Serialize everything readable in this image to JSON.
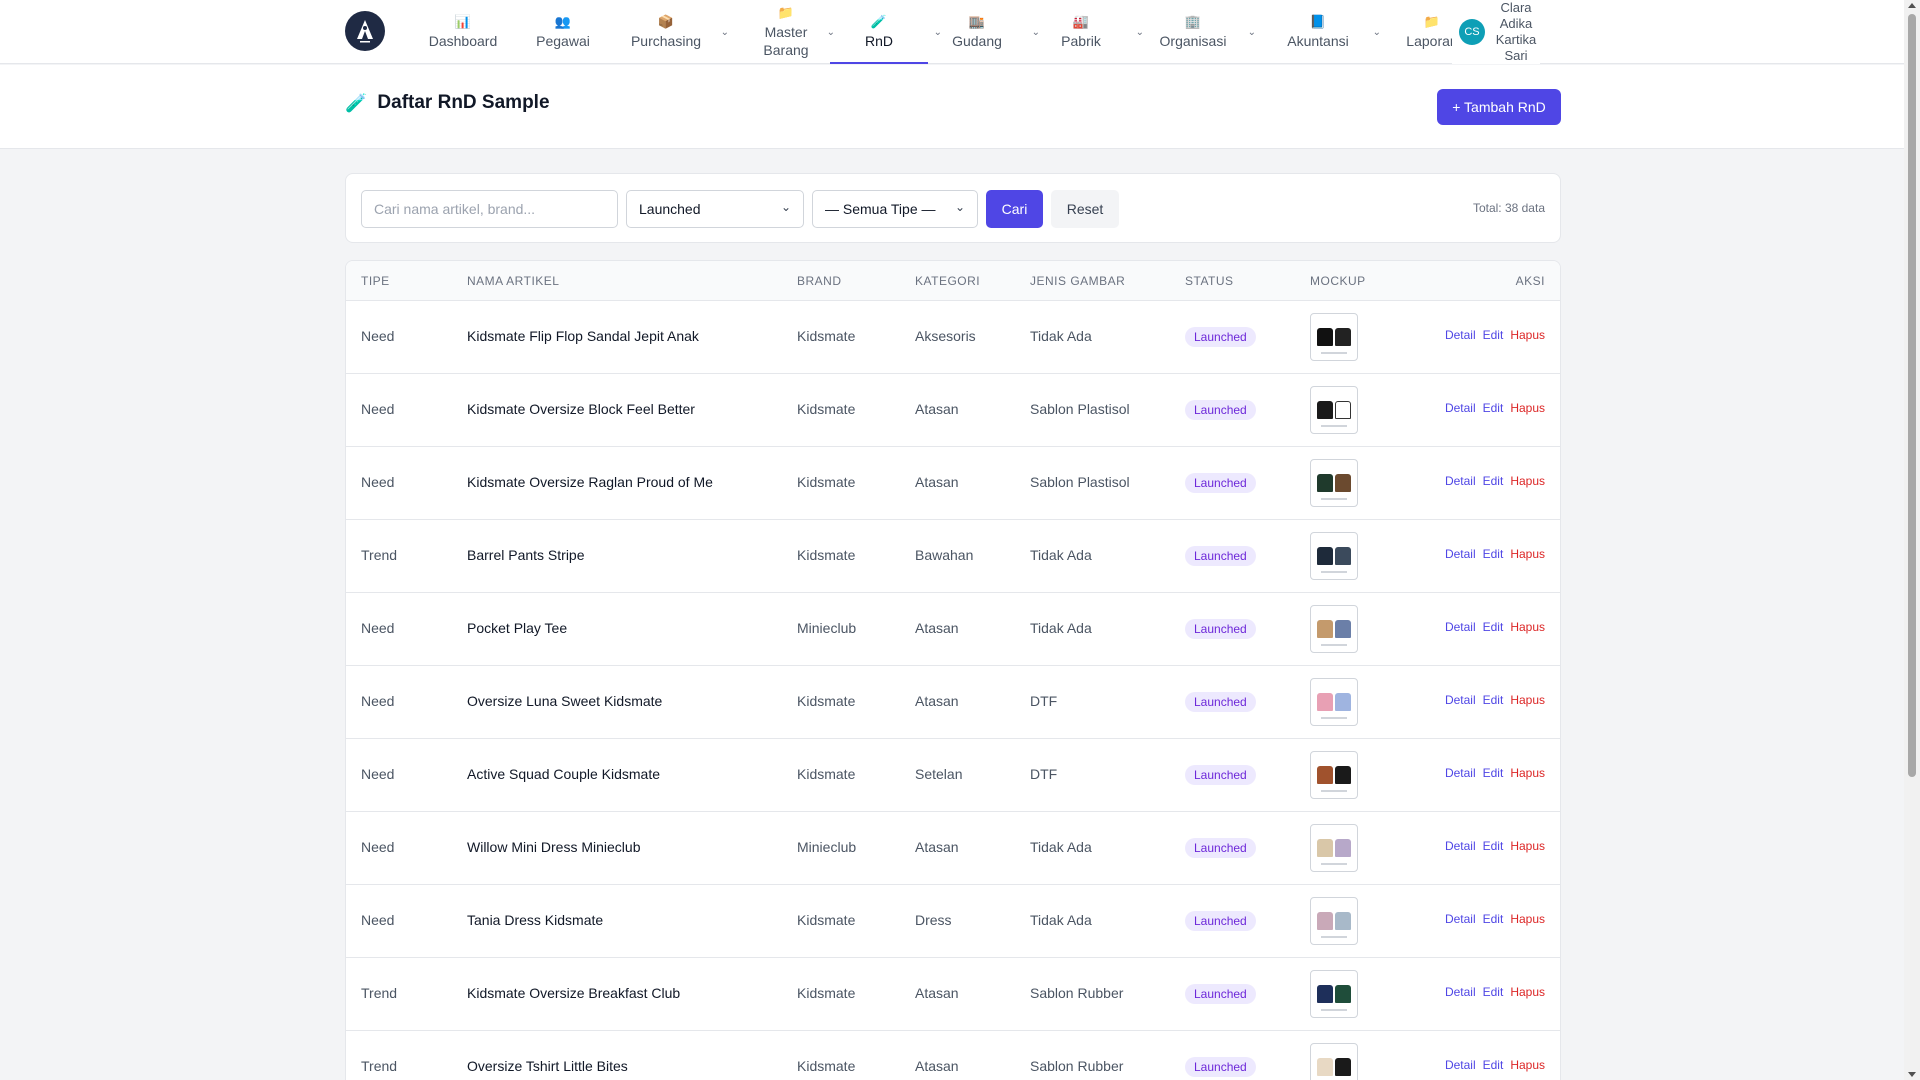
{
  "nav": {
    "logo_icon": "app-logo-icon",
    "items": [
      {
        "label": "Dashboard",
        "icon": "dashboard-icon",
        "glyph": "📊",
        "has_dropdown": false
      },
      {
        "label": "Pegawai",
        "icon": "people-icon",
        "glyph": "👥",
        "has_dropdown": false
      },
      {
        "label": "Purchasing",
        "icon": "package-icon",
        "glyph": "📦",
        "has_dropdown": true
      },
      {
        "label": "Master Barang",
        "icon": "folder-icon",
        "glyph": "📁",
        "has_dropdown": true
      },
      {
        "label": "RnD",
        "icon": "test-tube-icon",
        "glyph": "🧪",
        "has_dropdown": true,
        "active": true
      },
      {
        "label": "Gudang",
        "icon": "warehouse-icon",
        "glyph": "🏬",
        "has_dropdown": true
      },
      {
        "label": "Pabrik",
        "icon": "factory-icon",
        "glyph": "🏭",
        "has_dropdown": true
      },
      {
        "label": "Organisasi",
        "icon": "office-icon",
        "glyph": "🏢",
        "has_dropdown": true
      },
      {
        "label": "Akuntansi",
        "icon": "ledger-icon",
        "glyph": "📘",
        "has_dropdown": true
      },
      {
        "label": "Laporan",
        "icon": "folder-icon",
        "glyph": "📁",
        "has_dropdown": false
      }
    ],
    "user": {
      "initials": "CS",
      "name": "Clara Adika Kartika Sari"
    }
  },
  "header": {
    "title": "Daftar RnD Sample",
    "title_icon": "test-tube-icon",
    "add_button": "+ Tambah RnD"
  },
  "filters": {
    "search_placeholder": "Cari nama artikel, brand...",
    "status_selected": "Launched",
    "type_selected": "— Semua Tipe —",
    "search_button": "Cari",
    "reset_button": "Reset",
    "total": "Total: 38 data"
  },
  "table": {
    "columns": [
      "Tipe",
      "Nama Artikel",
      "Brand",
      "Kategori",
      "Jenis Gambar",
      "Status",
      "Mockup",
      "Aksi"
    ],
    "action_labels": {
      "detail": "Detail",
      "edit": "Edit",
      "delete": "Hapus"
    },
    "rows": [
      {
        "tipe": "Need",
        "nama": "Kidsmate Flip Flop Sandal Jepit Anak",
        "brand": "Kidsmate",
        "kategori": "Aksesoris",
        "jenis": "Tidak Ada",
        "status": "Launched",
        "mockup_colors": [
          "#111111",
          "#222222"
        ]
      },
      {
        "tipe": "Need",
        "nama": "Kidsmate Oversize Block Feel Better",
        "brand": "Kidsmate",
        "kategori": "Atasan",
        "jenis": "Sablon Plastisol",
        "status": "Launched",
        "mockup_colors": [
          "#1a1a1a",
          "#ffffff"
        ]
      },
      {
        "tipe": "Need",
        "nama": "Kidsmate Oversize Raglan Proud of Me",
        "brand": "Kidsmate",
        "kategori": "Atasan",
        "jenis": "Sablon Plastisol",
        "status": "Launched",
        "mockup_colors": [
          "#1f3a2c",
          "#6b4a2f"
        ]
      },
      {
        "tipe": "Trend",
        "nama": "Barrel Pants Stripe",
        "brand": "Kidsmate",
        "kategori": "Bawahan",
        "jenis": "Tidak Ada",
        "status": "Launched",
        "mockup_colors": [
          "#1e2a3a",
          "#3b4a5c"
        ]
      },
      {
        "tipe": "Need",
        "nama": "Pocket Play Tee",
        "brand": "Minieclub",
        "kategori": "Atasan",
        "jenis": "Tidak Ada",
        "status": "Launched",
        "mockup_colors": [
          "#c49a6c",
          "#6b7fa8"
        ]
      },
      {
        "tipe": "Need",
        "nama": "Oversize Luna Sweet Kidsmate",
        "brand": "Kidsmate",
        "kategori": "Atasan",
        "jenis": "DTF",
        "status": "Launched",
        "mockup_colors": [
          "#e8a0b4",
          "#9fb4e0"
        ]
      },
      {
        "tipe": "Need",
        "nama": "Active Squad Couple Kidsmate",
        "brand": "Kidsmate",
        "kategori": "Setelan",
        "jenis": "DTF",
        "status": "Launched",
        "mockup_colors": [
          "#a0522d",
          "#1a1a1a"
        ]
      },
      {
        "tipe": "Need",
        "nama": "Willow Mini Dress Minieclub",
        "brand": "Minieclub",
        "kategori": "Atasan",
        "jenis": "Tidak Ada",
        "status": "Launched",
        "mockup_colors": [
          "#d9c7a8",
          "#b7a8c9"
        ]
      },
      {
        "tipe": "Need",
        "nama": "Tania Dress Kidsmate",
        "brand": "Kidsmate",
        "kategori": "Dress",
        "jenis": "Tidak Ada",
        "status": "Launched",
        "mockup_colors": [
          "#c9a9b8",
          "#a8b9c9"
        ]
      },
      {
        "tipe": "Trend",
        "nama": "Kidsmate Oversize Breakfast Club",
        "brand": "Kidsmate",
        "kategori": "Atasan",
        "jenis": "Sablon Rubber",
        "status": "Launched",
        "mockup_colors": [
          "#1e2f5a",
          "#1f4d3a"
        ]
      },
      {
        "tipe": "Trend",
        "nama": "Oversize Tshirt Little Bites",
        "brand": "Kidsmate",
        "kategori": "Atasan",
        "jenis": "Sablon Rubber",
        "status": "Launched",
        "mockup_colors": [
          "#e8d9c4",
          "#1a1a1a"
        ]
      }
    ]
  },
  "colors": {
    "accent": "#4f46e5",
    "badge_bg": "#ede9fe",
    "badge_text": "#6d28d9",
    "danger": "#dc2626"
  }
}
